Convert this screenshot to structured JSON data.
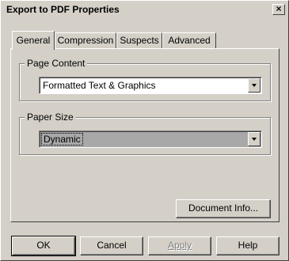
{
  "window": {
    "title": "Export to PDF Properties"
  },
  "tabs": [
    {
      "label": "General"
    },
    {
      "label": "Compression"
    },
    {
      "label": "Suspects"
    },
    {
      "label": "Advanced"
    }
  ],
  "page_content": {
    "legend": "Page Content",
    "selected": "Formatted Text & Graphics"
  },
  "paper_size": {
    "legend": "Paper Size",
    "selected": "Dynamic"
  },
  "document_info_button": "Document Info...",
  "footer": {
    "ok": "OK",
    "cancel": "Cancel",
    "apply": "Apply",
    "help": "Help"
  },
  "icons": {
    "close": "close-icon",
    "dropdown": "chevron-down-icon"
  }
}
